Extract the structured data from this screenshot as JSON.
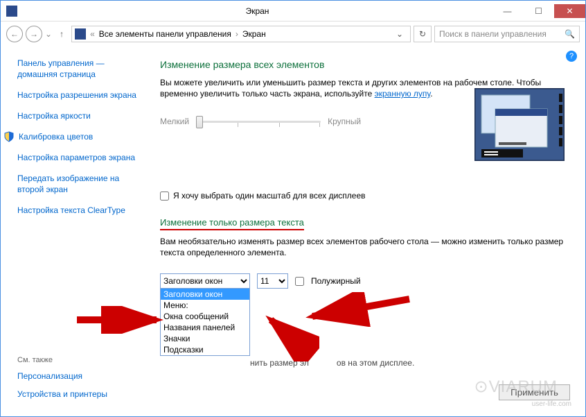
{
  "window": {
    "title": "Экран",
    "min": "—",
    "max": "☐",
    "close": "✕"
  },
  "nav": {
    "back": "←",
    "forward": "→",
    "up": "↑",
    "breadcrumb_sep1": "«",
    "breadcrumb_root": "Все элементы панели управления",
    "breadcrumb_sep2": "›",
    "breadcrumb_current": "Экран",
    "dropdown": "⌄",
    "refresh": "↻",
    "search_placeholder": "Поиск в панели управления",
    "search_icon": "🔍"
  },
  "sidebar": {
    "links": [
      "Панель управления — домашняя страница",
      "Настройка разрешения экрана",
      "Настройка яркости",
      "Калибровка цветов",
      "Настройка параметров экрана",
      "Передать изображение на второй экран",
      "Настройка текста ClearType"
    ],
    "see_also": "См. также",
    "bottom_links": [
      "Персонализация",
      "Устройства и принтеры"
    ]
  },
  "main": {
    "help": "?",
    "heading1": "Изменение размера всех элементов",
    "desc1_a": "Вы можете увеличить или уменьшить размер текста и других элементов на рабочем столе. Чтобы временно увеличить только часть экрана, используйте ",
    "desc1_link": "экранную лупу",
    "desc1_b": ".",
    "slider_small": "Мелкий",
    "slider_large": "Крупный",
    "checkbox_label": "Я хочу выбрать один масштаб для всех дисплеев",
    "heading2": "Изменение только размера текста",
    "desc2": "Вам необязательно изменять размер всех элементов рабочего стола — можно изменить только размер текста определенного элемента.",
    "select_element_value": "Заголовки окон",
    "select_size_value": "11",
    "checkbox_bold": "Полужирный",
    "dropdown_options": [
      "Заголовки окон",
      "Меню:",
      "Окна сообщений",
      "Названия панелей",
      "Значки",
      "Подсказки"
    ],
    "note_partial": "нить размер эл            ов на этом дисплее.",
    "apply": "Применить"
  },
  "watermark": "⊙VIARUM",
  "watermark2": "user-life.com"
}
